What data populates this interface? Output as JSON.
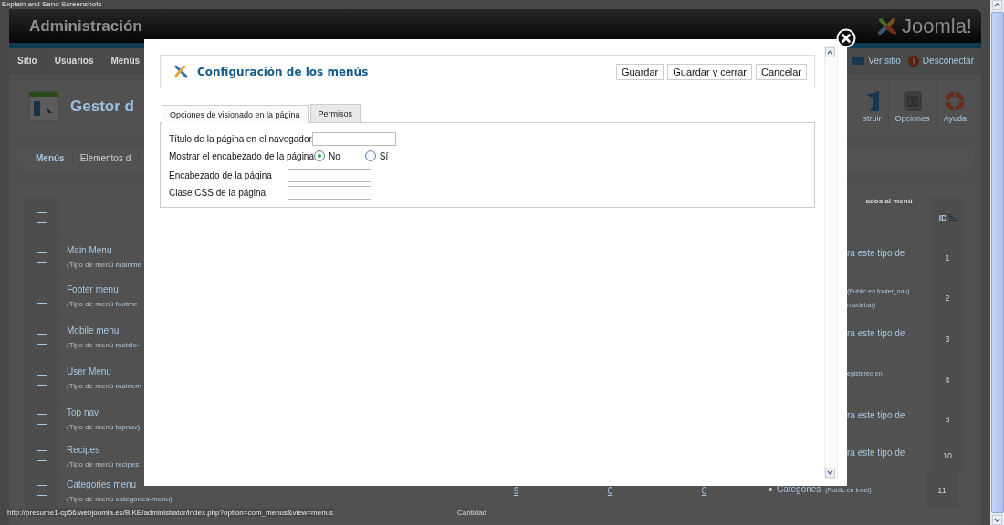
{
  "capture_label": "Explain and Send Screenshots",
  "header": {
    "title": "Administración",
    "logo_text": "Joomla!"
  },
  "nav": {
    "items": [
      {
        "label": "Sitio"
      },
      {
        "label": "Usuarios"
      },
      {
        "label": "Menús"
      }
    ],
    "links": [
      {
        "label": "Ver sitio",
        "kind": "site"
      },
      {
        "label": "Desconectar",
        "kind": "logout"
      }
    ]
  },
  "toolbar": {
    "title": "Gestor d",
    "buttons": [
      {
        "label": "struir",
        "kind": "rebuild"
      },
      {
        "label": "Opciones",
        "kind": "options"
      },
      {
        "label": "Ayuda",
        "kind": "help"
      }
    ]
  },
  "submenu": [
    {
      "label": "Menús",
      "selected": true
    },
    {
      "label": "Elementos d",
      "selected": false
    }
  ],
  "table": {
    "select_all_checked": false,
    "columns": [
      {
        "label": "ados al menú"
      },
      {
        "label": "ID"
      }
    ],
    "rows": [
      {
        "checked": false,
        "title": "Main Menu",
        "type_label": "(Tipo de menú",
        "type": "mainme",
        "modules": [
          {
            "kind": "text",
            "label": "ra este tipo de"
          }
        ],
        "id": "1"
      },
      {
        "checked": false,
        "title": "Footer menu",
        "type_label": "(Tipo de menú",
        "type": "footme",
        "modules": [
          {
            "kind": "note",
            "label": "(Public en footer_nav)"
          },
          {
            "kind": "note",
            "label": "n sidebar)"
          }
        ],
        "id": "2"
      },
      {
        "checked": false,
        "title": "Mobile menu",
        "type_label": "(Tipo de menú",
        "type": "mobile-",
        "modules": [
          {
            "kind": "text",
            "label": "ra este tipo de"
          }
        ],
        "id": "3"
      },
      {
        "checked": false,
        "title": "User Menu",
        "type_label": "(Tipo de menú",
        "type": "mainem",
        "modules": [
          {
            "kind": "note",
            "label": "egistered en"
          }
        ],
        "id": "4"
      },
      {
        "checked": false,
        "title": "Top nav",
        "type_label": "(Tipo de menú",
        "type": "topnav)",
        "modules": [
          {
            "kind": "text",
            "label": "ra este tipo de"
          }
        ],
        "id": "8"
      },
      {
        "checked": false,
        "title": "Recipes",
        "type_label": "(Tipo de menú",
        "type": "recipes",
        "modules": [
          {
            "kind": "text",
            "label": "ra este tipo de"
          }
        ],
        "id": "10"
      },
      {
        "checked": false,
        "title": "Categories menu",
        "type_label": "(Tipo de menú",
        "type": "categories-menu)",
        "counts": [
          "9",
          "0",
          "0"
        ],
        "modules": [
          {
            "kind": "bullet",
            "label": "Categories",
            "note": "(Public en inset)"
          }
        ],
        "id": "11"
      }
    ]
  },
  "footer": {
    "label": "Cantidad"
  },
  "status_url": "http://presume1-cp56.webjoomla.es/BIKE/administrator/index.php?option=com_menus&view=menus",
  "modal": {
    "title": "Configuración de los menús",
    "buttons": [
      {
        "label": "Guardar"
      },
      {
        "label": "Guardar y cerrar"
      },
      {
        "label": "Cancelar"
      }
    ],
    "tabs": [
      {
        "label": "Opciones de visionado en la página",
        "selected": true
      },
      {
        "label": "Permisos",
        "selected": false
      }
    ],
    "fields": [
      {
        "kind": "text",
        "label": "Título de la página en el navegador"
      },
      {
        "kind": "radio",
        "label": "Mostrar el encabezado de la página",
        "options": [
          {
            "label": "No",
            "selected": true
          },
          {
            "label": "Sí",
            "selected": false
          }
        ]
      },
      {
        "kind": "text",
        "label": "Encabezado de la página"
      },
      {
        "kind": "text",
        "label": "Clase CSS de la página"
      }
    ]
  }
}
